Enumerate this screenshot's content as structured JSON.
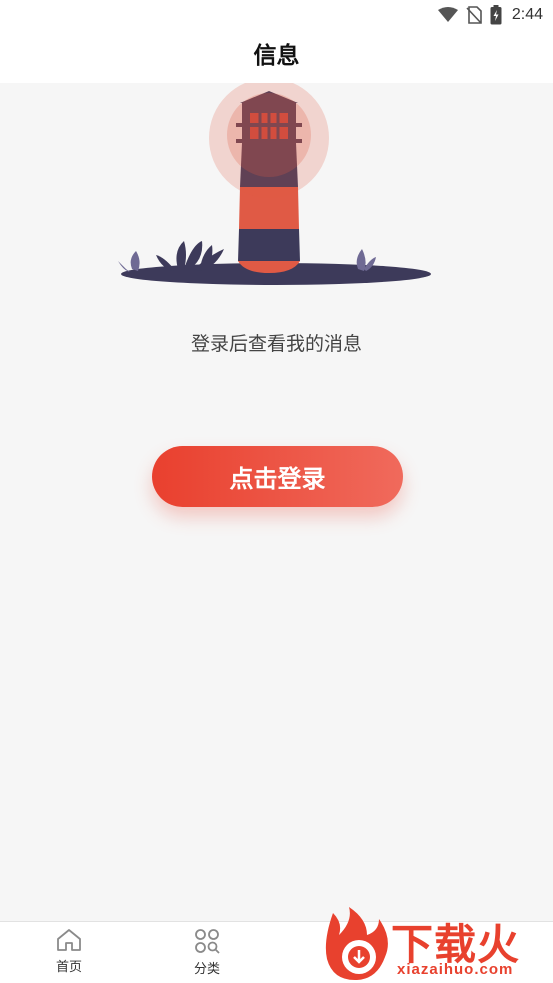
{
  "status_bar": {
    "time": "2:44",
    "icons": [
      "wifi-icon",
      "no-sim-icon",
      "battery-charging-icon"
    ]
  },
  "header": {
    "title": "信息"
  },
  "main": {
    "illustration": "lighthouse-illustration",
    "hint": "登录后查看我的消息",
    "login_button": "点击登录"
  },
  "tab_bar": {
    "tabs": [
      {
        "label": "首页",
        "icon": "home-icon"
      },
      {
        "label": "分类",
        "icon": "category-icon"
      }
    ]
  },
  "watermark": {
    "brand": "下载火",
    "url": "xiazaihuo.com"
  },
  "colors": {
    "accent": "#e9402e",
    "accent_light": "#f06a5c",
    "lighthouse_dark": "#3d3a5a",
    "background": "#f6f6f6"
  }
}
